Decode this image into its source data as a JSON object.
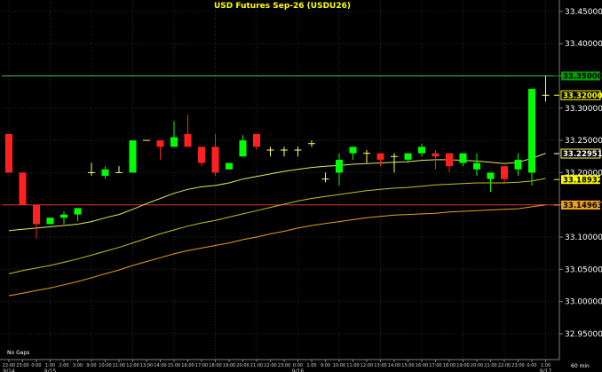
{
  "chart_data": {
    "type": "candlestick",
    "title": "USD  Futures  Sep-26  (USDU26)",
    "interval_label": "60  min",
    "gaps_label": "No Gaps",
    "ylim": [
      32.91,
      33.465
    ],
    "y_ticks": [
      "33.45000",
      "33.40000",
      "33.35000",
      "33.30000",
      "33.25000",
      "33.20000",
      "33.15000",
      "33.10000",
      "33.05000",
      "33.00000",
      "32.95000"
    ],
    "y_tick_values": [
      33.45,
      33.4,
      33.35,
      33.3,
      33.25,
      33.2,
      33.15,
      33.1,
      33.05,
      33.0,
      32.95
    ],
    "grid": true,
    "x_labels": [
      "22:00",
      "23:00",
      "0:00",
      "1:00",
      "2:00",
      "3:00",
      "9:00",
      "10:00",
      "11:00",
      "12:00",
      "13:00",
      "14:00",
      "15:00",
      "16:00",
      "17:00",
      "18:00",
      "19:00",
      "20:00",
      "21:00",
      "22:00",
      "23:00",
      "0:00",
      "1:00",
      "9:00",
      "10:00",
      "11:00",
      "12:00",
      "13:00",
      "14:00",
      "15:00",
      "16:00",
      "17:00",
      "18:00",
      "19:00",
      "20:00",
      "21:00",
      "22:00",
      "23:00",
      "0:00",
      "1:00"
    ],
    "date_labels": [
      {
        "index": 0,
        "text": "9/14"
      },
      {
        "index": 3,
        "text": "9/15"
      },
      {
        "index": 21,
        "text": "9/16"
      },
      {
        "index": 39,
        "text": "9/17"
      }
    ],
    "candles": [
      {
        "o": 33.26,
        "h": 33.26,
        "l": 33.2,
        "c": 33.2
      },
      {
        "o": 33.2,
        "h": 33.2,
        "l": 33.15,
        "c": 33.15
      },
      {
        "o": 33.15,
        "h": 33.15,
        "l": 33.098,
        "c": 33.12
      },
      {
        "o": 33.12,
        "h": 33.13,
        "l": 33.12,
        "c": 33.13
      },
      {
        "o": 33.13,
        "h": 33.14,
        "l": 33.12,
        "c": 33.135
      },
      {
        "o": 33.135,
        "h": 33.14,
        "l": 33.125,
        "c": 33.145
      },
      {
        "o": 33.2,
        "h": 33.215,
        "l": 33.195,
        "c": 33.2
      },
      {
        "o": 33.195,
        "h": 33.21,
        "l": 33.19,
        "c": 33.205
      },
      {
        "o": 33.2,
        "h": 33.21,
        "l": 33.2,
        "c": 33.2
      },
      {
        "o": 33.2,
        "h": 33.25,
        "l": 33.2,
        "c": 33.25
      },
      {
        "o": 33.25,
        "h": 33.25,
        "l": 33.25,
        "c": 33.25
      },
      {
        "o": 33.25,
        "h": 33.25,
        "l": 33.22,
        "c": 33.24
      },
      {
        "o": 33.24,
        "h": 33.28,
        "l": 33.24,
        "c": 33.255
      },
      {
        "o": 33.26,
        "h": 33.29,
        "l": 33.245,
        "c": 33.24
      },
      {
        "o": 33.24,
        "h": 33.24,
        "l": 33.21,
        "c": 33.215
      },
      {
        "o": 33.24,
        "h": 33.26,
        "l": 33.195,
        "c": 33.2
      },
      {
        "o": 33.205,
        "h": 33.21,
        "l": 33.205,
        "c": 33.215
      },
      {
        "o": 33.225,
        "h": 33.258,
        "l": 33.225,
        "c": 33.25
      },
      {
        "o": 33.26,
        "h": 33.26,
        "l": 33.235,
        "c": 33.24
      },
      {
        "o": 33.235,
        "h": 33.24,
        "l": 33.225,
        "c": 33.235
      },
      {
        "o": 33.235,
        "h": 33.24,
        "l": 33.225,
        "c": 33.235
      },
      {
        "o": 33.235,
        "h": 33.24,
        "l": 33.225,
        "c": 33.235
      },
      {
        "o": 33.245,
        "h": 33.25,
        "l": 33.24,
        "c": 33.245
      },
      {
        "o": 33.19,
        "h": 33.2,
        "l": 33.185,
        "c": 33.19
      },
      {
        "o": 33.2,
        "h": 33.23,
        "l": 33.18,
        "c": 33.22
      },
      {
        "o": 33.23,
        "h": 33.24,
        "l": 33.22,
        "c": 33.24
      },
      {
        "o": 33.23,
        "h": 33.235,
        "l": 33.215,
        "c": 33.23
      },
      {
        "o": 33.23,
        "h": 33.23,
        "l": 33.21,
        "c": 33.22
      },
      {
        "o": 33.225,
        "h": 33.23,
        "l": 33.2,
        "c": 33.225
      },
      {
        "o": 33.22,
        "h": 33.23,
        "l": 33.215,
        "c": 33.23
      },
      {
        "o": 33.23,
        "h": 33.245,
        "l": 33.225,
        "c": 33.24
      },
      {
        "o": 33.23,
        "h": 33.235,
        "l": 33.205,
        "c": 33.225
      },
      {
        "o": 33.23,
        "h": 33.23,
        "l": 33.2,
        "c": 33.21
      },
      {
        "o": 33.215,
        "h": 33.23,
        "l": 33.21,
        "c": 33.23
      },
      {
        "o": 33.205,
        "h": 33.23,
        "l": 33.195,
        "c": 33.215
      },
      {
        "o": 33.19,
        "h": 33.195,
        "l": 33.17,
        "c": 33.2
      },
      {
        "o": 33.21,
        "h": 33.21,
        "l": 33.185,
        "c": 33.19
      },
      {
        "o": 33.205,
        "h": 33.23,
        "l": 33.195,
        "c": 33.22
      },
      {
        "o": 33.2,
        "h": 33.33,
        "l": 33.18,
        "c": 33.33
      },
      {
        "o": 33.32,
        "h": 33.35,
        "l": 33.31,
        "c": 33.32
      }
    ],
    "indicator_lines": [
      {
        "color": "#e8e860",
        "values": [
          33.11,
          33.112,
          33.114,
          33.116,
          33.118,
          33.12,
          33.124,
          33.13,
          33.135,
          33.143,
          33.152,
          33.16,
          33.168,
          33.174,
          33.178,
          33.18,
          33.184,
          33.19,
          33.194,
          33.198,
          33.202,
          33.205,
          33.208,
          33.21,
          33.211,
          33.213,
          33.214,
          33.215,
          33.216,
          33.217,
          33.219,
          33.22,
          33.22,
          33.219,
          33.218,
          33.216,
          33.214,
          33.216,
          33.222,
          33.23
        ]
      },
      {
        "color": "#c8c020",
        "values": [
          33.043,
          33.048,
          33.052,
          33.056,
          33.061,
          33.066,
          33.072,
          33.078,
          33.084,
          33.091,
          33.098,
          33.105,
          33.111,
          33.117,
          33.122,
          33.126,
          33.131,
          33.136,
          33.141,
          33.146,
          33.151,
          33.156,
          33.16,
          33.163,
          33.166,
          33.169,
          33.172,
          33.174,
          33.176,
          33.177,
          33.179,
          33.181,
          33.182,
          33.183,
          33.184,
          33.184,
          33.184,
          33.185,
          33.187,
          33.191
        ]
      },
      {
        "color": "#e8a020",
        "values": [
          33.009,
          33.013,
          33.017,
          33.021,
          33.026,
          33.031,
          33.037,
          33.043,
          33.049,
          33.056,
          33.062,
          33.068,
          33.074,
          33.079,
          33.083,
          33.087,
          33.091,
          33.096,
          33.1,
          33.105,
          33.109,
          33.114,
          33.118,
          33.121,
          33.124,
          33.127,
          33.13,
          33.132,
          33.134,
          33.135,
          33.136,
          33.137,
          33.139,
          33.14,
          33.141,
          33.142,
          33.143,
          33.144,
          33.147,
          33.15
        ]
      }
    ],
    "horizontal_lines": [
      {
        "value": 33.35,
        "color": "#3fbf3f"
      },
      {
        "value": 33.15,
        "color": "#e03030"
      }
    ],
    "price_tags": [
      {
        "text": "33.35000",
        "value": 33.35,
        "bg": "#00a000",
        "fg": "#000000"
      },
      {
        "text": "33.32000",
        "value": 33.32,
        "bg": "#000000",
        "fg": "#ffff00",
        "border": "#ffff00"
      },
      {
        "text": "33.22951",
        "value": 33.2295,
        "bg": "#000000",
        "fg": "#ffffff",
        "border": "#ffff60"
      },
      {
        "text": "33.18932",
        "value": 33.1893,
        "bg": "#ffff00",
        "fg": "#000000"
      },
      {
        "text": "33.15000",
        "value": 33.15,
        "bg": "#ff2020",
        "fg": "#000000"
      },
      {
        "text": "33.14963",
        "value": 33.1496,
        "bg": "#e8a020",
        "fg": "#000000"
      }
    ],
    "colors": {
      "up": "#00ff00",
      "down": "#ff2020",
      "neutral": "#ffff60",
      "grid": "#2a2a2a",
      "axis": "#808080"
    }
  }
}
